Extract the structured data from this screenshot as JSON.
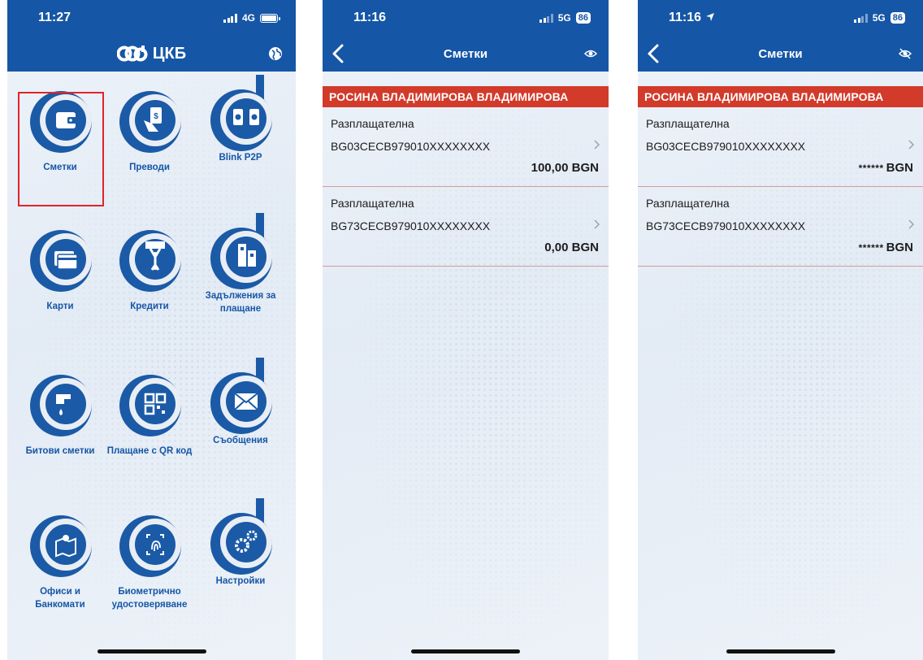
{
  "screen1": {
    "status": {
      "time": "11:27",
      "network": "4G"
    },
    "header": {
      "brand": "ЦКБ"
    },
    "tiles": [
      {
        "label": "Сметки"
      },
      {
        "label": "Преводи"
      },
      {
        "label": "Blink P2P"
      },
      {
        "label": "Карти"
      },
      {
        "label": "Кредити"
      },
      {
        "label": "Задължения за плащане"
      },
      {
        "label": "Битови сметки"
      },
      {
        "label": "Плащане с QR код"
      },
      {
        "label": "Съобщения"
      },
      {
        "label": "Офиси и Банкомати"
      },
      {
        "label": "Биометрично удостоверяване"
      },
      {
        "label": "Настройки"
      }
    ],
    "highlighted_tile": "Сметки"
  },
  "screen2": {
    "status": {
      "time": "11:16",
      "network": "5G",
      "battery": "86"
    },
    "navbar": {
      "title": "Сметки"
    },
    "owner": "РОСИНА ВЛАДИМИРОВА ВЛАДИМИРОВА",
    "accounts": [
      {
        "type": "Разплащателна",
        "iban": "BG03CECB979010XXXXXXXX",
        "amount": "100,00 BGN"
      },
      {
        "type": "Разплащателна",
        "iban": "BG73CECB979010XXXXXXXX",
        "amount": "0,00 BGN"
      }
    ]
  },
  "screen3": {
    "status": {
      "time": "11:16",
      "network": "5G",
      "battery": "86"
    },
    "navbar": {
      "title": "Сметки"
    },
    "owner": "РОСИНА ВЛАДИМИРОВА ВЛАДИМИРОВА",
    "accounts": [
      {
        "type": "Разплащателна",
        "iban": "BG03CECB979010XXXXXXXX",
        "masked": "******",
        "currency": "BGN"
      },
      {
        "type": "Разплащателна",
        "iban": "BG73CECB979010XXXXXXXX",
        "masked": "******",
        "currency": "BGN"
      }
    ]
  },
  "colors": {
    "primary": "#1556a6",
    "owner_bar": "#d23a2a",
    "highlight": "#e0242b"
  }
}
